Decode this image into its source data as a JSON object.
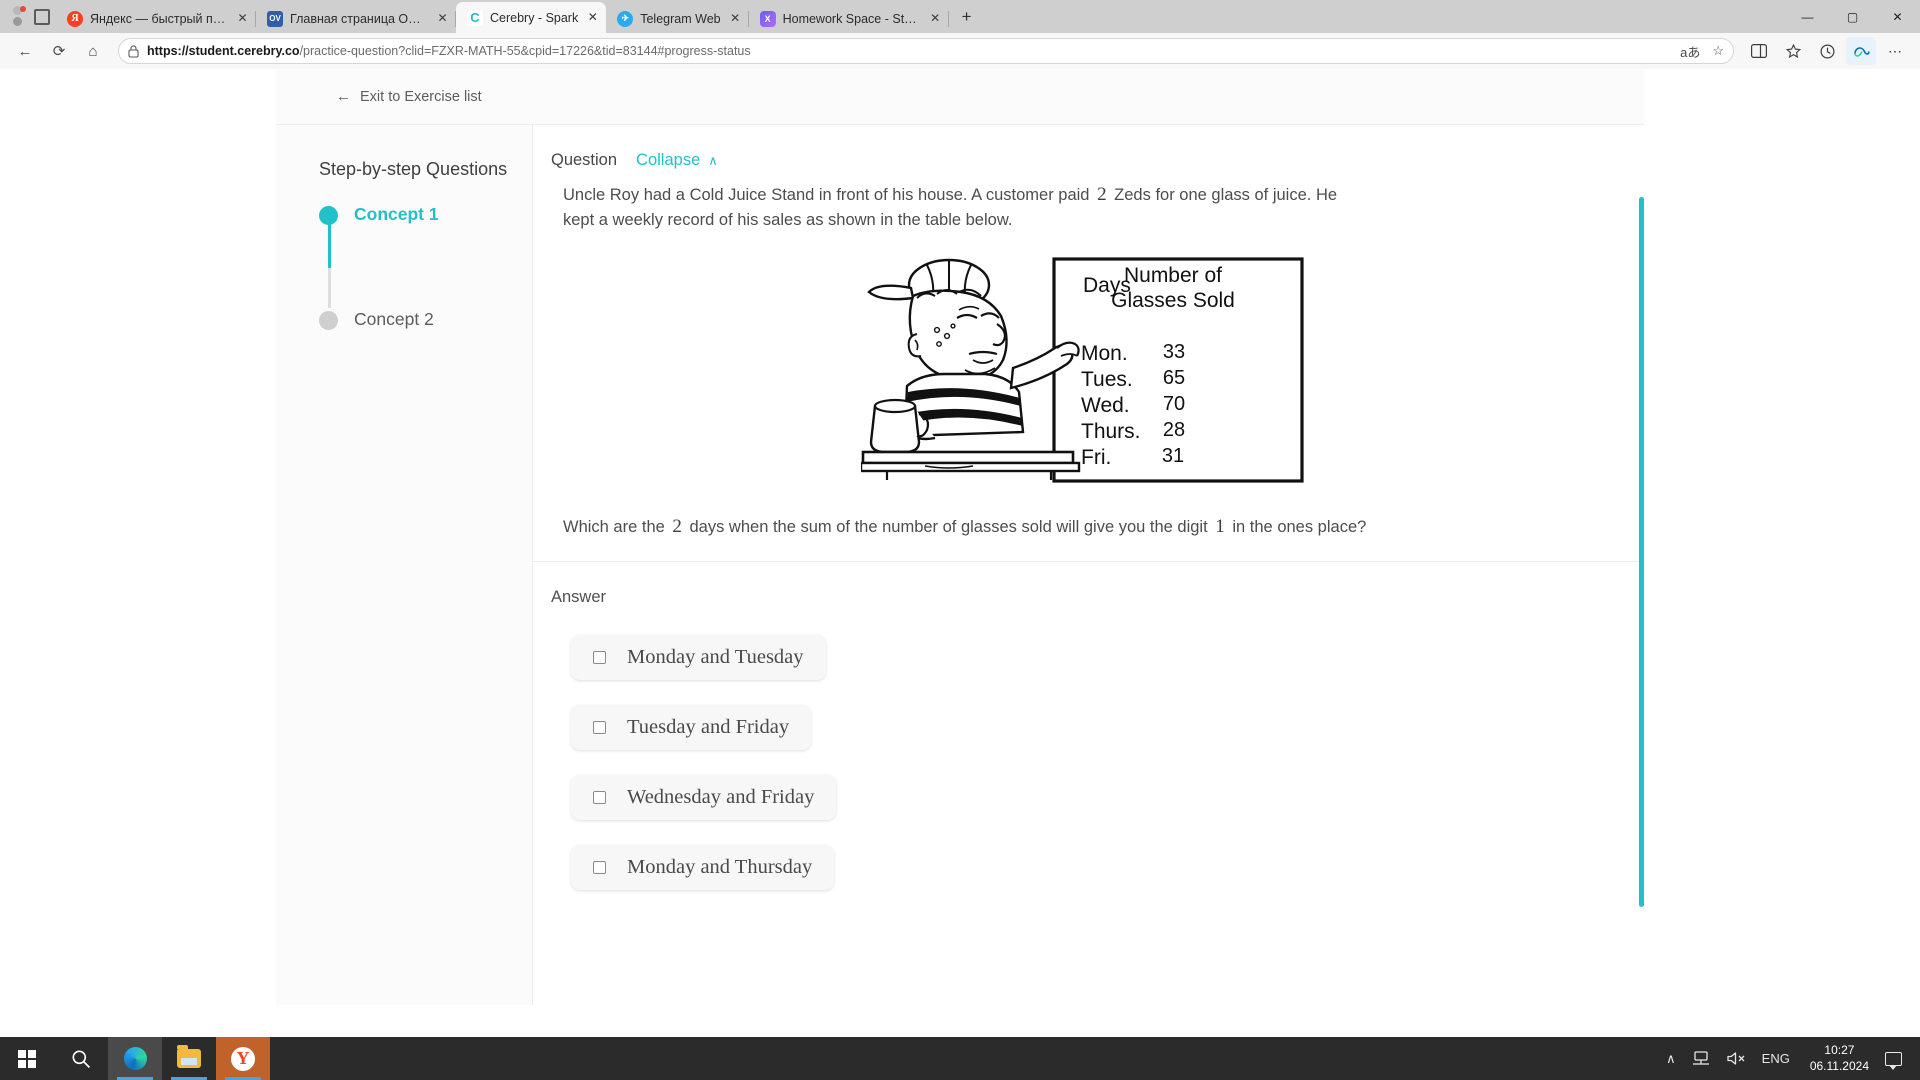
{
  "browser": {
    "tabs": [
      {
        "title": "Яндекс — быстрый поиск в инте",
        "favicon": "yandex-icon",
        "close": "✕",
        "active": false
      },
      {
        "title": "Главная страница OVGorskiy",
        "favicon": "ovg-icon",
        "close": "✕",
        "active": false
      },
      {
        "title": "Cerebry - Spark",
        "favicon": "cerebry-icon",
        "close": "✕",
        "active": true
      },
      {
        "title": "Telegram Web",
        "favicon": "telegram-icon",
        "close": "✕",
        "active": false
      },
      {
        "title": "Homework Space - StudyX",
        "favicon": "studyx-icon",
        "close": "✕",
        "active": false
      }
    ],
    "new_tab": "+",
    "window_controls": {
      "minimize": "—",
      "maximize": "▢",
      "close": "✕"
    },
    "nav": {
      "back": "←",
      "refresh": "⟳",
      "home": "⌂"
    },
    "address": {
      "lock_icon": "lock-icon",
      "url_host": "https://student.cerebry.co",
      "url_path": "/practice-question?clid=FZXR-MATH-55&cpid=17226&tid=83144#progress-status",
      "translate_icon": "aあ",
      "favorite_icon": "☆"
    },
    "toolbar_icons": [
      "split-screen-icon",
      "favorites-icon",
      "history-icon",
      "copilot-icon",
      "settings-more-icon"
    ]
  },
  "page": {
    "exit_link": {
      "arrow": "←",
      "label": "Exit to Exercise list"
    },
    "sidebar": {
      "title": "Step-by-step Questions",
      "steps": [
        {
          "label": "Concept 1",
          "state": "active"
        },
        {
          "label": "Concept 2",
          "state": "inactive"
        }
      ]
    },
    "question": {
      "header_label": "Question",
      "collapse_label": "Collapse",
      "collapse_chevron": "∧",
      "body_part1": "Uncle Roy had a Cold Juice Stand in front of his house. A customer paid",
      "body_num1": "2",
      "body_part2": "Zeds for one glass of juice. He kept a weekly record of his sales as shown in the table below.",
      "prompt_part1": "Which are the",
      "prompt_num1": "2",
      "prompt_part2": "days when the sum of the number of glasses sold will give you the digit",
      "prompt_num2": "1",
      "prompt_part3": "in the ones place?"
    },
    "figure": {
      "alt": "cartoon boy at juice stand with sales table",
      "table_headers": [
        "Days",
        "Number of Glasses Sold"
      ],
      "table_rows": [
        {
          "day": "Mon.",
          "glasses": "33"
        },
        {
          "day": "Tues.",
          "glasses": "65"
        },
        {
          "day": "Wed.",
          "glasses": "70"
        },
        {
          "day": "Thurs.",
          "glasses": "28"
        },
        {
          "day": "Fri.",
          "glasses": "31"
        }
      ]
    },
    "answer": {
      "label": "Answer",
      "options": [
        {
          "text": "Monday and Tuesday",
          "checked": false
        },
        {
          "text": "Tuesday and Friday",
          "checked": false
        },
        {
          "text": "Wednesday and Friday",
          "checked": false
        },
        {
          "text": "Monday and Thursday",
          "checked": false
        }
      ]
    },
    "accent_color": "#22c0c9"
  },
  "taskbar": {
    "start": "start-icon",
    "search": "search-icon",
    "apps": [
      "edge-icon",
      "file-explorer-icon",
      "yandex-browser-icon"
    ],
    "tray": {
      "chevron": "∧",
      "network": "network-icon",
      "volume": "volume-muted-icon",
      "language": "ENG",
      "time": "10:27",
      "date": "06.11.2024",
      "notifications": "notification-icon"
    }
  }
}
